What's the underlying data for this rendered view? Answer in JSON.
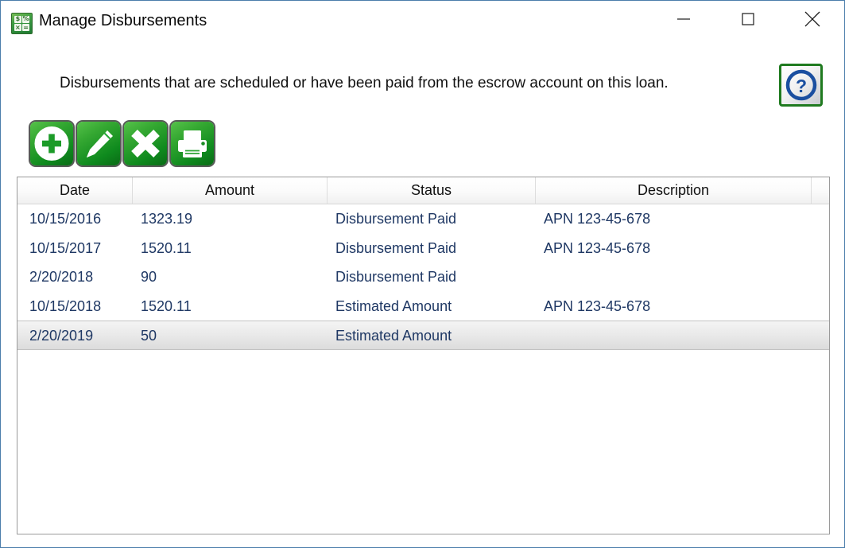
{
  "window": {
    "title": "Manage Disbursements",
    "app_icon": "calculator-icon",
    "icon_keys": [
      "$",
      "%",
      "×",
      "="
    ],
    "controls": {
      "minimize": "minimize-icon",
      "maximize": "maximize-icon",
      "close": "close-icon"
    },
    "border_color": "#4b7dab"
  },
  "header": {
    "description": "Disbursements that are scheduled or have been paid from the escrow account on this loan.",
    "help_label": "?"
  },
  "toolbar": {
    "buttons": [
      {
        "name": "add-button",
        "icon": "plus-circle-icon"
      },
      {
        "name": "edit-button",
        "icon": "pencil-icon"
      },
      {
        "name": "delete-button",
        "icon": "x-mark-icon"
      },
      {
        "name": "print-button",
        "icon": "printer-icon"
      }
    ],
    "accent_color": "#1f8a23"
  },
  "table": {
    "columns": [
      "Date",
      "Amount",
      "Status",
      "Description"
    ],
    "rows": [
      {
        "date": "10/15/2016",
        "amount": "1323.19",
        "status": "Disbursement Paid",
        "description": "APN 123-45-678",
        "selected": false
      },
      {
        "date": "10/15/2017",
        "amount": "1520.11",
        "status": "Disbursement Paid",
        "description": "APN 123-45-678",
        "selected": false
      },
      {
        "date": "2/20/2018",
        "amount": "90",
        "status": "Disbursement Paid",
        "description": "",
        "selected": false
      },
      {
        "date": "10/15/2018",
        "amount": "1520.11",
        "status": "Estimated Amount",
        "description": "APN 123-45-678",
        "selected": false
      },
      {
        "date": "2/20/2019",
        "amount": "50",
        "status": "Estimated Amount",
        "description": "",
        "selected": true
      }
    ],
    "text_color": "#1f3864",
    "selected_row_index": 4
  }
}
